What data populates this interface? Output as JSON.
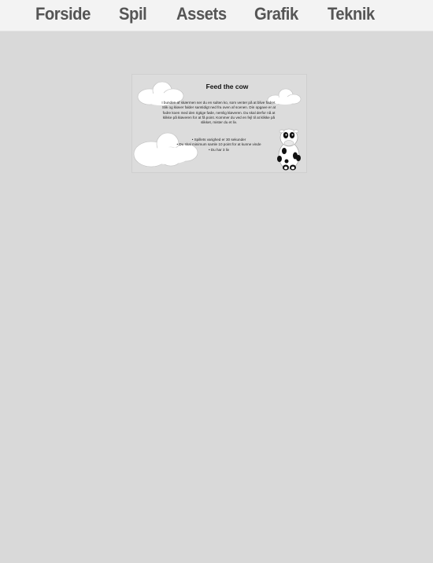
{
  "nav": {
    "items": [
      {
        "label": "Forside"
      },
      {
        "label": "Spil"
      },
      {
        "label": "Assets"
      },
      {
        "label": "Grafik"
      },
      {
        "label": "Teknik"
      }
    ]
  },
  "game": {
    "title": "Feed the cow",
    "description": "I bunden af skærmen ser du en sulten ko, som venter på at blive fodret. Slik og kløver falder samtidigt ned fra oven af scenen. Din opgave er at fodre koen med den rigtige føde, nemlig kløveren. Du skal derfor nå at klikke på kløveren for at få point. Kommer du ved en fejl til at klikke på slikket, mister du et liv.",
    "rules": [
      "• Spillets varighed er 30 sekunder",
      "• Du skal minimum samle 10 point for at kunne vinde",
      "• Du har 3 liv"
    ]
  },
  "colors": {
    "page_background": "#d9d9d9",
    "navbar_background": "#f3f3f3",
    "nav_text": "#555555",
    "cloud": "#ffffff",
    "cow_spots": "#111111"
  }
}
